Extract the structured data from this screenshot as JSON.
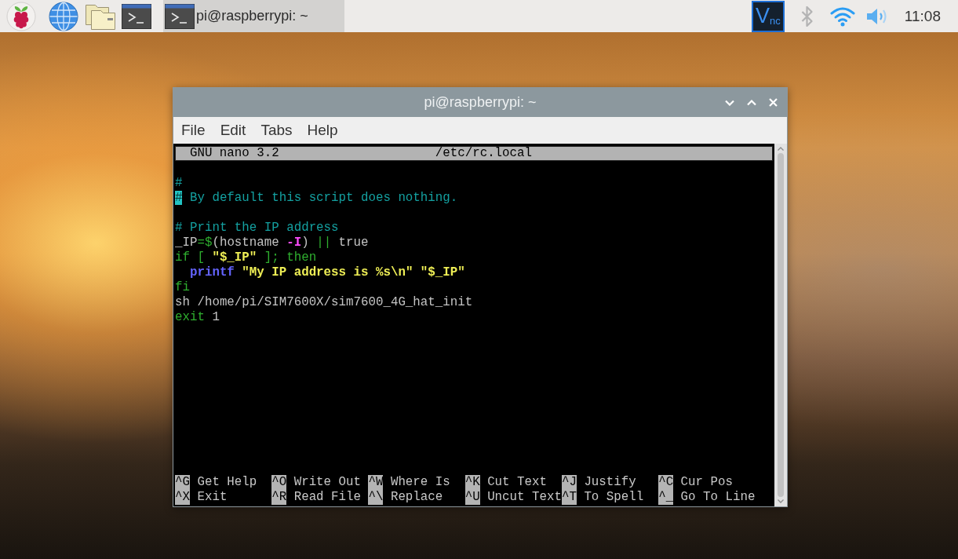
{
  "taskbar": {
    "tasks": [
      {
        "label": "pi@raspberrypi: ~",
        "selected": true
      }
    ],
    "tray": {
      "vnc_logo": "V$_{nc}$",
      "clock": "11:08"
    }
  },
  "window": {
    "title": "pi@raspberrypi: ~",
    "menu": [
      "File",
      "Edit",
      "Tabs",
      "Help"
    ],
    "nano": {
      "version": "GNU nano 3.2",
      "file": "/etc/rc.local",
      "lines": [
        {
          "kind": "code",
          "segments": [
            {
              "text": "#",
              "kind": "comment"
            }
          ]
        },
        {
          "kind": "code",
          "segments": [
            {
              "text": "#",
              "kind": "cursor"
            },
            {
              "text": " By default this script does nothing.",
              "kind": "comment"
            }
          ]
        },
        {
          "kind": "blank"
        },
        {
          "kind": "code",
          "segments": [
            {
              "text": "# Print the IP address",
              "kind": "comment"
            }
          ]
        },
        {
          "kind": "code",
          "segments": [
            {
              "text": "_IP",
              "kind": "plain"
            },
            {
              "text": "=$",
              "kind": "keyword"
            },
            {
              "text": "(hostname ",
              "kind": "plain"
            },
            {
              "text": "-I",
              "kind": "option"
            },
            {
              "text": ") ",
              "kind": "plain"
            },
            {
              "text": "||",
              "kind": "keyword"
            },
            {
              "text": " true",
              "kind": "plain"
            }
          ]
        },
        {
          "kind": "code",
          "segments": [
            {
              "text": "if [ ",
              "kind": "keyword"
            },
            {
              "text": "\"$_IP\"",
              "kind": "string"
            },
            {
              "text": " ]; then",
              "kind": "keyword"
            }
          ]
        },
        {
          "kind": "code",
          "segments": [
            {
              "text": "  printf",
              "kind": "builtin"
            },
            {
              "text": " \"My IP address is %s\\n\" \"$_IP\"",
              "kind": "string"
            }
          ]
        },
        {
          "kind": "code",
          "segments": [
            {
              "text": "fi",
              "kind": "keyword"
            }
          ]
        },
        {
          "kind": "code",
          "segments": [
            {
              "text": "sh /home/pi/SIM7600X/sim7600_4G_hat_init",
              "kind": "plain"
            }
          ]
        },
        {
          "kind": "code",
          "segments": [
            {
              "text": "exit",
              "kind": "keyword"
            },
            {
              "text": " 1",
              "kind": "plain"
            }
          ]
        }
      ],
      "shortcuts": [
        {
          "key": "^G",
          "label": "Get Help"
        },
        {
          "key": "^O",
          "label": "Write Out"
        },
        {
          "key": "^W",
          "label": "Where Is"
        },
        {
          "key": "^K",
          "label": "Cut Text"
        },
        {
          "key": "^J",
          "label": "Justify"
        },
        {
          "key": "^C",
          "label": "Cur Pos"
        },
        {
          "key": "^X",
          "label": "Exit"
        },
        {
          "key": "^R",
          "label": "Read File"
        },
        {
          "key": "^\\",
          "label": "Replace"
        },
        {
          "key": "^U",
          "label": "Uncut Text"
        },
        {
          "key": "^T",
          "label": "To Spell"
        },
        {
          "key": "^_",
          "label": "Go To Line"
        }
      ]
    }
  }
}
